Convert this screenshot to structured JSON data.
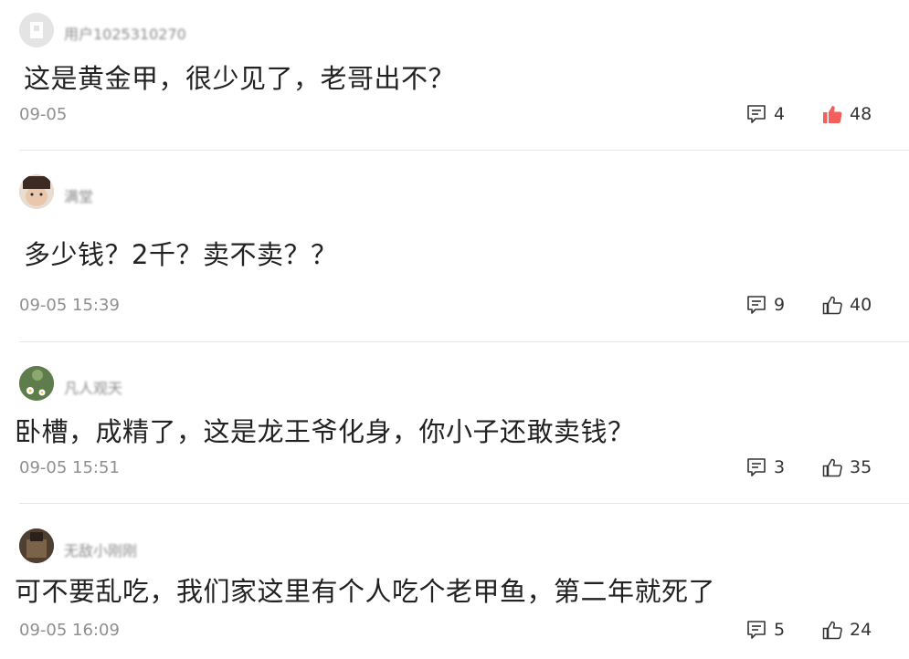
{
  "comments": [
    {
      "username": "用户1025310270",
      "avatar_color": "#e2e2e2",
      "text": "这是黄金甲，很少见了，老哥出不？",
      "time": "09-05",
      "reply_count": "4",
      "like_count": "48",
      "liked": true
    },
    {
      "username": "满堂",
      "avatar_color": "#c9b8a6",
      "text": "多少钱？2千？卖不卖？？",
      "time": "09-05 15:39",
      "reply_count": "9",
      "like_count": "40",
      "liked": false
    },
    {
      "username": "凡人观天",
      "avatar_color": "#6e8a5a",
      "text": "卧槽，成精了，这是龙王爷化身，你小子还敢卖钱？",
      "time": "09-05 15:51",
      "reply_count": "3",
      "like_count": "35",
      "liked": false
    },
    {
      "username": "无敌小刚刚",
      "avatar_color": "#5a4a3a",
      "text": "可不要乱吃，我们家这里有个人吃个老甲鱼，第二年就死了",
      "time": "09-05 16:09",
      "reply_count": "5",
      "like_count": "24",
      "liked": false
    }
  ],
  "colors": {
    "liked": "#f25f5c",
    "icon": "#333333",
    "muted": "#8f8f8f"
  },
  "icons": {
    "reply": "comment-bubble-icon",
    "like": "thumbs-up-icon"
  }
}
